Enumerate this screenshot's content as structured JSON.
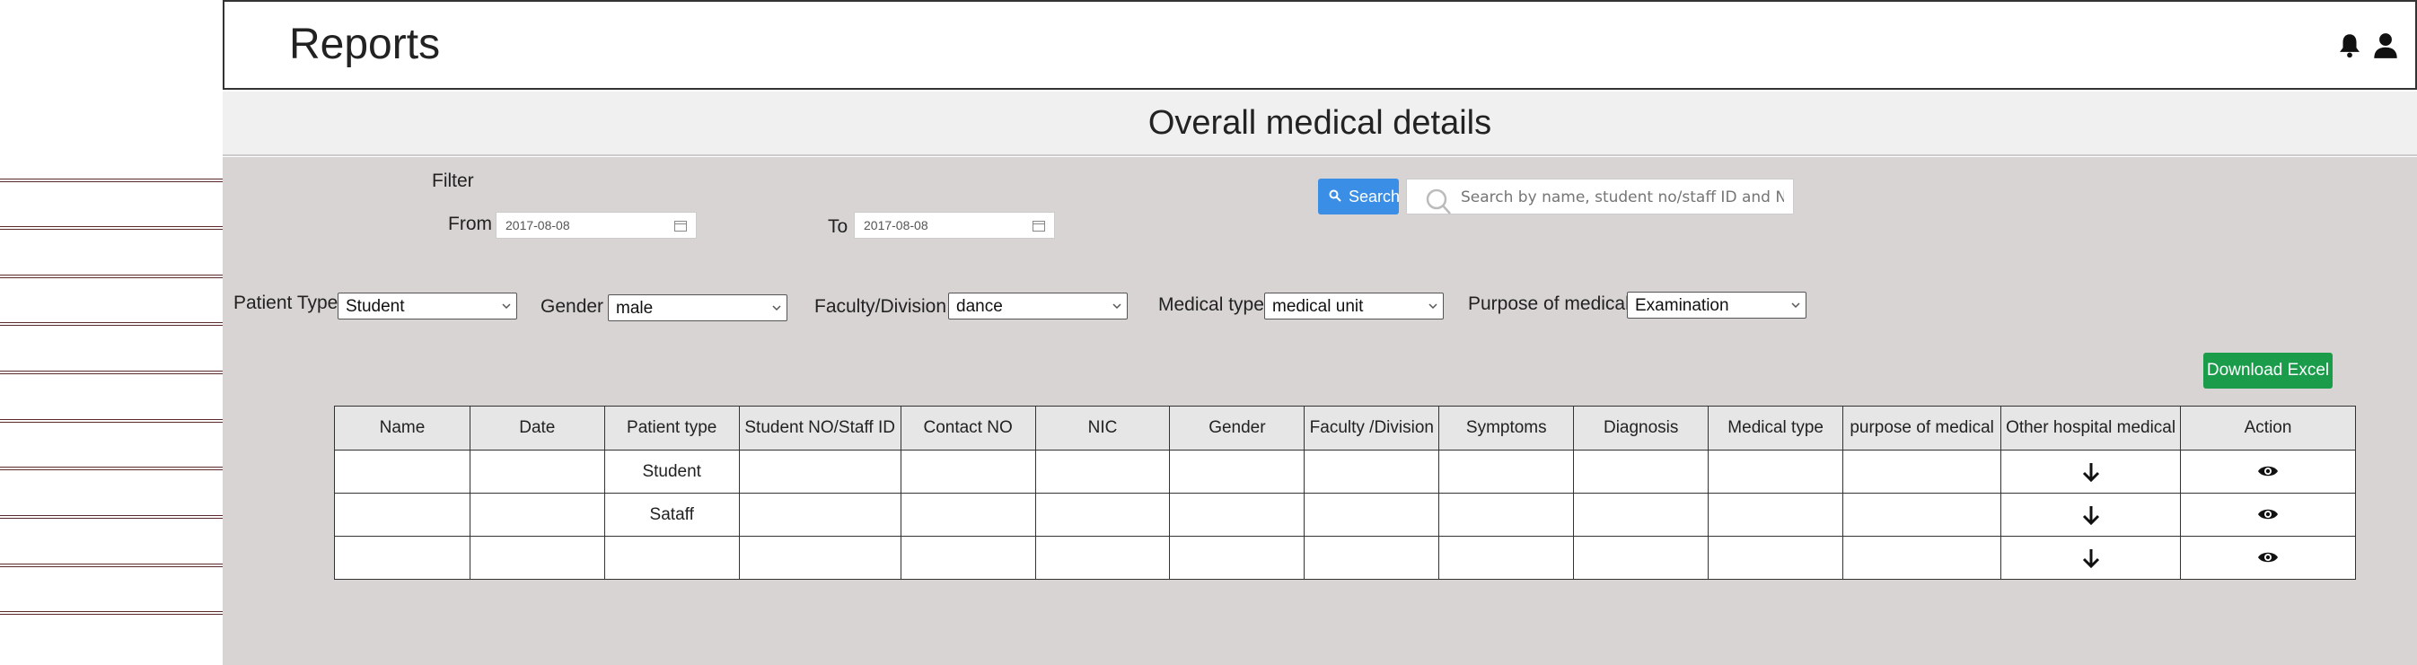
{
  "header": {
    "title": "Reports"
  },
  "section": {
    "title": "Overall medical details"
  },
  "filter": {
    "title": "Filter",
    "from_label": "From",
    "from_value": "2017-08-08",
    "to_label": "To",
    "to_value": "2017-08-08",
    "search_button": "Search",
    "search_placeholder": "Search by name, student no/staff ID and NIC"
  },
  "selects": [
    {
      "label": "Patient Type",
      "value": "Student"
    },
    {
      "label": "Gender",
      "value": "male"
    },
    {
      "label": "Faculty/Division",
      "value": "dance"
    },
    {
      "label": "Medical type",
      "value": "medical unit"
    },
    {
      "label": "Purpose of medical",
      "value": "Examination"
    }
  ],
  "download_button": "Download Excel",
  "table": {
    "headers": [
      "Name",
      "Date",
      "Patient type",
      "Student NO/Staff ID",
      "Contact NO",
      "NIC",
      "Gender",
      "Faculty /Division",
      "Symptoms",
      "Diagnosis",
      "Medical type",
      "purpose of medical",
      "Other hospital medical",
      "Action"
    ],
    "rows": [
      {
        "patient_type": "Student"
      },
      {
        "patient_type": "Sataff"
      },
      {
        "patient_type": ""
      }
    ]
  },
  "icons": {
    "bell": "bell-icon",
    "user": "user-icon",
    "download": "arrow-down-icon",
    "view": "eye-icon"
  },
  "colors": {
    "search_button": "#3a8ee6",
    "download_button": "#1a9c4b",
    "content_bg": "#d8d4d3"
  }
}
